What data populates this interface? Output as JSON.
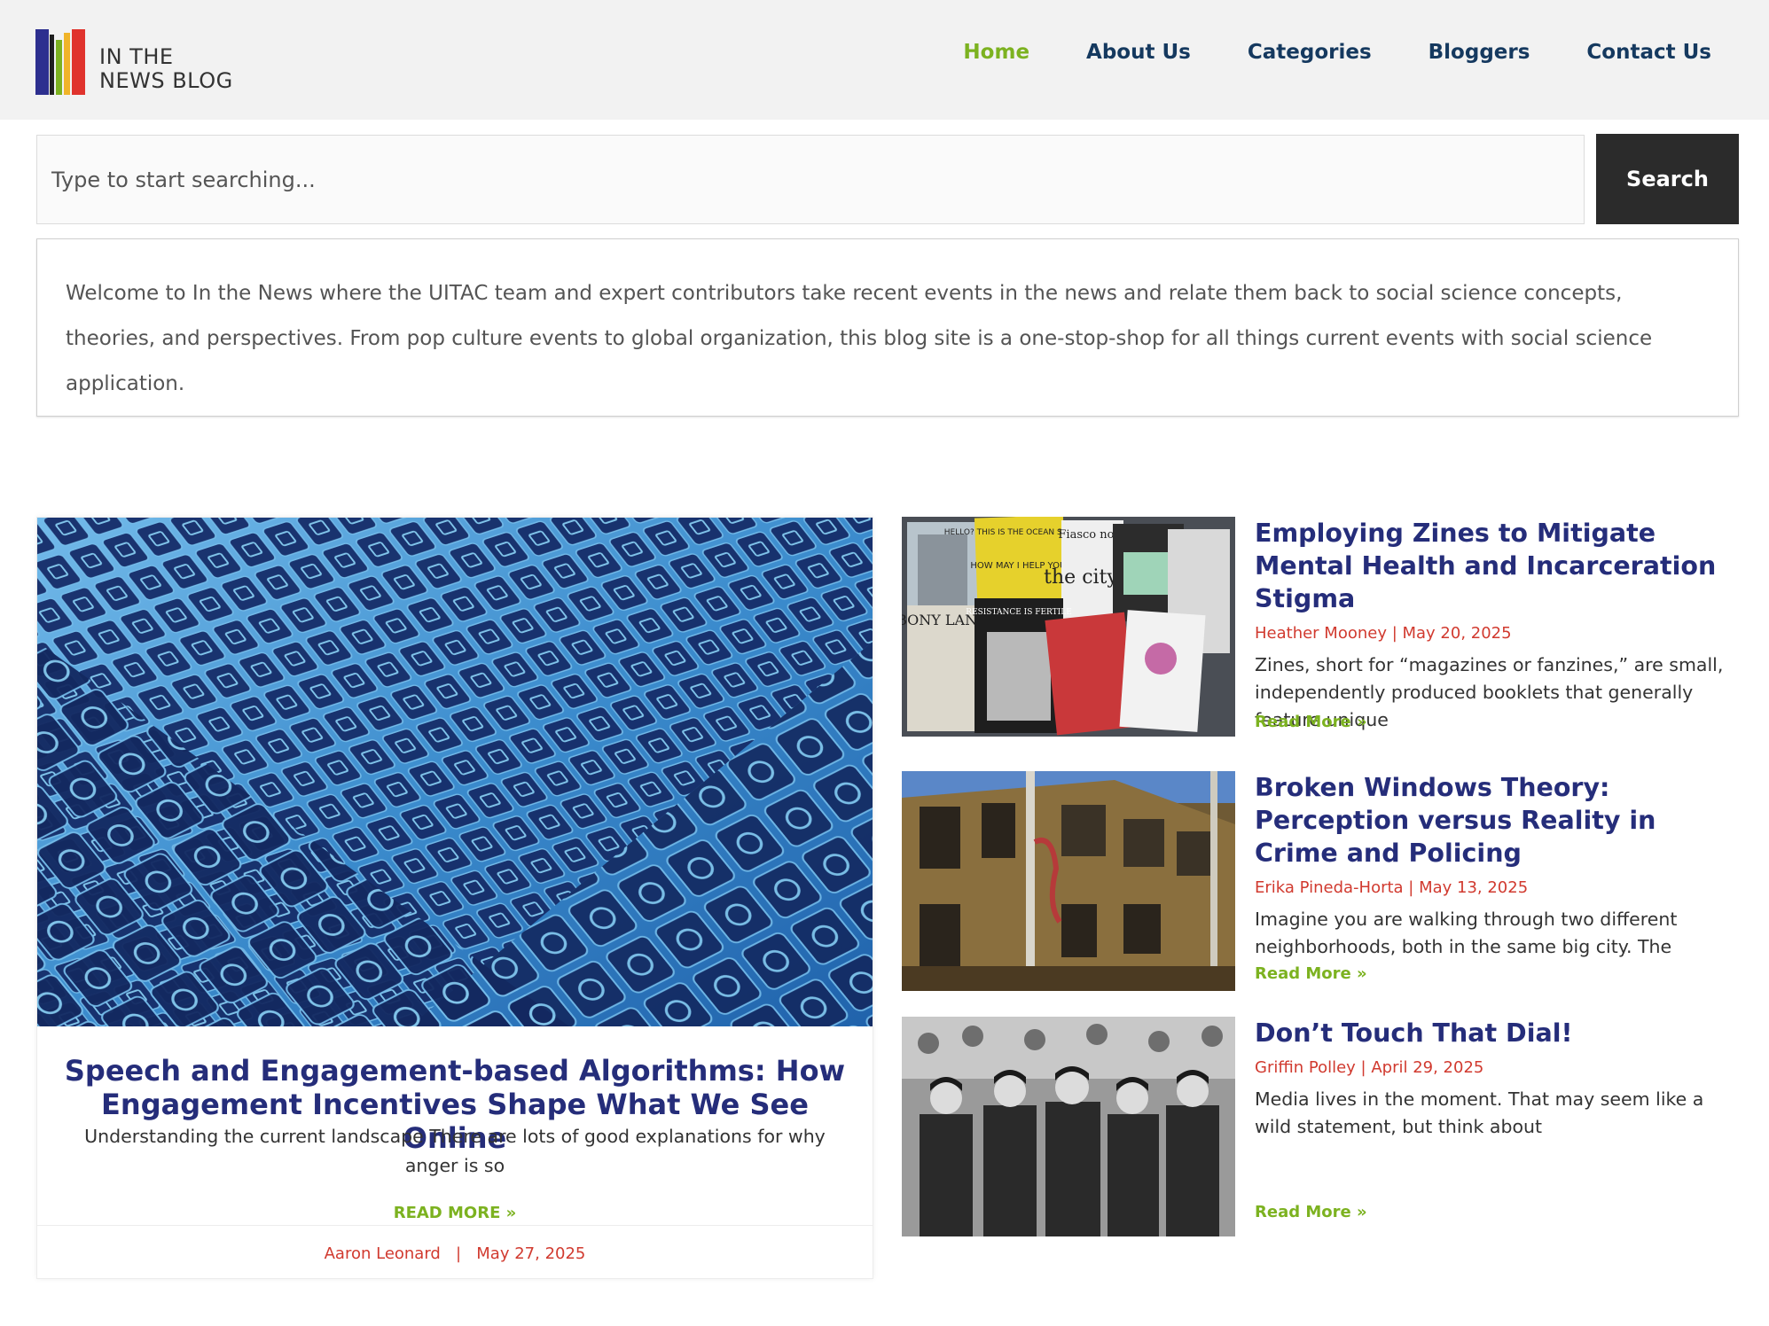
{
  "header": {
    "logo_line1": "IN THE",
    "logo_line2": "NEWS BLOG",
    "logo_colors": [
      "#2d2f8f",
      "#1f1f1f",
      "#7cb220",
      "#f0b429",
      "#e0332d"
    ],
    "nav": [
      {
        "label": "Home",
        "active": true
      },
      {
        "label": "About Us",
        "active": false
      },
      {
        "label": "Categories",
        "active": false
      },
      {
        "label": "Bloggers",
        "active": false
      },
      {
        "label": "Contact Us",
        "active": false
      }
    ]
  },
  "search": {
    "placeholder": "Type to start searching...",
    "button_label": "Search"
  },
  "intro": {
    "text": "Welcome to In the News where the UITAC team and expert contributors take recent events in the news and relate them back to social science concepts, theories, and perspectives. From pop culture events to global organization, this blog site is a one-stop-shop for all things current events with social science application."
  },
  "featured": {
    "title": "Speech and Engagement-based Algorithms: How Engagement Incentives Shape What We See Online",
    "excerpt": "Understanding the current landscape  There are lots of good explanations for why anger is so",
    "read_more": "READ MORE »",
    "author": "Aaron Leonard",
    "separator": "|",
    "date": "May 27, 2025",
    "image_icons": "social-media-icons"
  },
  "posts": [
    {
      "title": "Employing Zines to Mitigate Mental Health and Incarceration Stigma",
      "meta": "Heather Mooney | May 20, 2025",
      "excerpt": "Zines, short for “magazines or fanzines,” are small, independently produced booklets that generally feature unique",
      "read_more": "Read More »",
      "image_text": [
        "HELLO? THIS IS THE OCEAN SPEAKING",
        "HOW MAY I HELP YOU?",
        "Fiasco no.2",
        "the city",
        "BONY LAND",
        "RESISTANCE IS FERTILE"
      ]
    },
    {
      "title": "Broken Windows Theory: Perception versus Reality in Crime and Policing",
      "meta": "Erika Pineda-Horta | May 13, 2025",
      "excerpt": "Imagine you are walking through two different neighborhoods, both in the same big city. The",
      "read_more": "Read More »"
    },
    {
      "title": "Don’t Touch That Dial!",
      "meta": "Griffin Polley | April 29, 2025",
      "excerpt": "Media lives in the moment. That may seem like a wild statement, but think about",
      "read_more": "Read More »"
    }
  ]
}
